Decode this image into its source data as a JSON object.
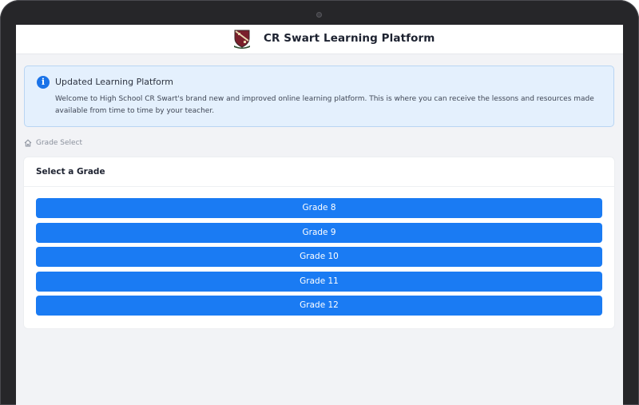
{
  "header": {
    "title": "CR Swart Learning Platform",
    "logo_icon": "school-crest-icon"
  },
  "alert": {
    "icon": "info-icon",
    "icon_glyph": "i",
    "title": "Updated Learning Platform",
    "body": "Welcome to High School CR Swart's brand new and improved online learning platform. This is where you can receive the lessons and resources made available from time to time by your teacher."
  },
  "breadcrumb": {
    "icon": "home-icon",
    "label": "Grade Select"
  },
  "grade_card": {
    "title": "Select a Grade",
    "grades": [
      "Grade 8",
      "Grade 9",
      "Grade 10",
      "Grade 11",
      "Grade 12"
    ]
  },
  "colors": {
    "primary_button": "#1a7bf3",
    "alert_background": "#e4f0fd",
    "alert_border": "#b9d5f3",
    "info_icon": "#1a73e8",
    "crest_maroon": "#7a1f2b"
  }
}
